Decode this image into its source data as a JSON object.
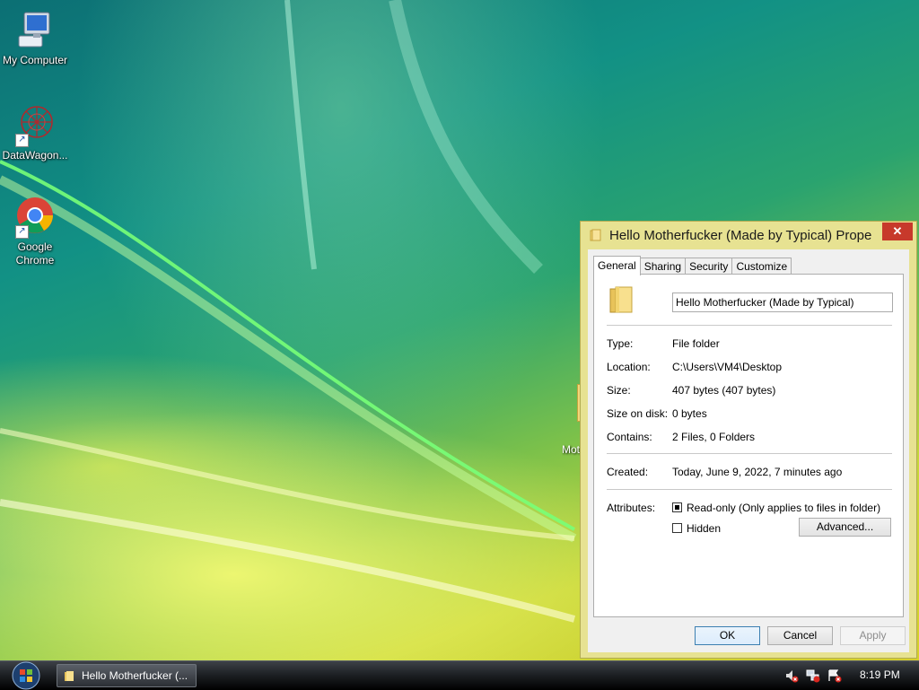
{
  "desktop": {
    "icons": [
      {
        "label": "My Computer",
        "icon": "computer-icon"
      },
      {
        "label": "DataWagon...",
        "icon": "datawagon-icon"
      },
      {
        "label_line1": "Google",
        "label_line2": "Chrome",
        "icon": "chrome-icon"
      }
    ],
    "hidden_folder_label": "Mot"
  },
  "dialog": {
    "title": "Hello Motherfucker (Made by Typical) Prope...",
    "close_label": "✕",
    "tabs": [
      "General",
      "Sharing",
      "Security",
      "Customize"
    ],
    "active_tab": "General",
    "name_value": "Hello Motherfucker (Made by Typical)",
    "fields": {
      "type_label": "Type:",
      "type_value": "File folder",
      "location_label": "Location:",
      "location_value": "C:\\Users\\VM4\\Desktop",
      "size_label": "Size:",
      "size_value": "407 bytes (407 bytes)",
      "size_on_disk_label": "Size on disk:",
      "size_on_disk_value": "0 bytes",
      "contains_label": "Contains:",
      "contains_value": "2 Files, 0 Folders",
      "created_label": "Created:",
      "created_value": "Today, June 9, 2022, 7 minutes ago",
      "attributes_label": "Attributes:"
    },
    "attributes": {
      "readonly_label": "Read-only (Only applies to files in folder)",
      "readonly_state": "indeterminate",
      "hidden_label": "Hidden",
      "hidden_checked": false
    },
    "buttons": {
      "advanced": "Advanced...",
      "ok": "OK",
      "cancel": "Cancel",
      "apply": "Apply"
    }
  },
  "taskbar": {
    "task_label": "Hello Motherfucker (...",
    "clock": "8:19 PM",
    "tray_icons": [
      "volume-muted-icon",
      "network-icon",
      "action-center-alert-icon"
    ]
  },
  "colors": {
    "dialog_frame": "#e7e292",
    "close_button": "#c7392b",
    "folder": "#f4d77a"
  }
}
